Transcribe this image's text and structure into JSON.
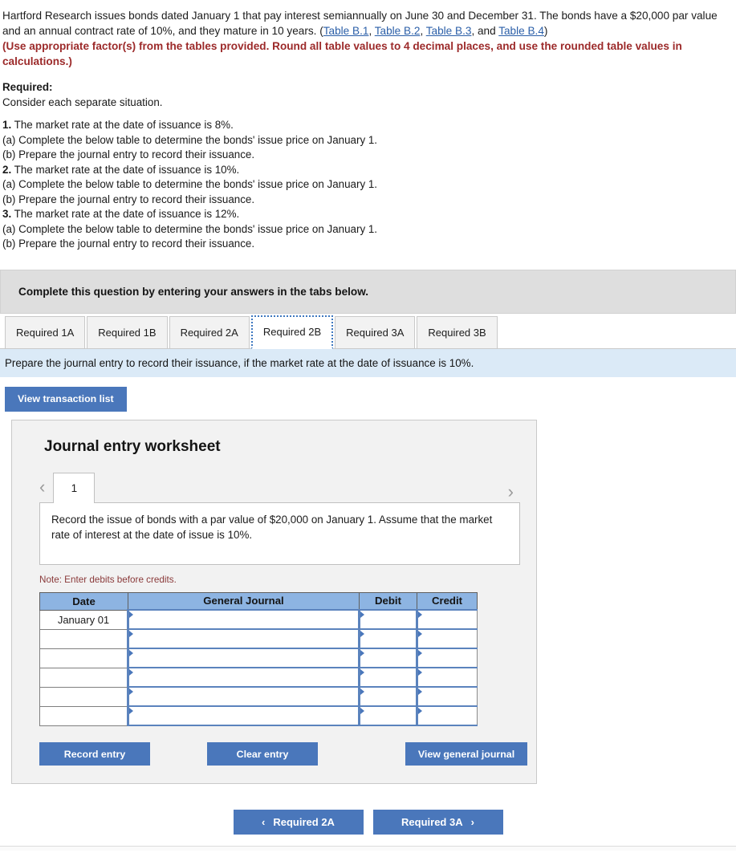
{
  "problem": {
    "paragraph_part1": "Hartford Research issues bonds dated January 1 that pay interest semiannually on June 30 and December 31. The bonds have a $20,000 par value and an annual contract rate of 10%, and they mature in 10 years. (",
    "links": [
      "Table B.1",
      "Table B.2",
      "Table B.3",
      "Table B.4"
    ],
    "sep_comma": ", ",
    "sep_and": ", and ",
    "paragraph_part2": ")",
    "emphasis": "(Use appropriate factor(s) from the tables provided. Round all table values to 4 decimal places, and use the rounded table values in calculations.)"
  },
  "required": {
    "title": "Required:",
    "subtitle": "Consider each separate situation.",
    "items": [
      {
        "num": "1.",
        "text": " The market rate at the date of issuance is 8%."
      },
      {
        "num": "",
        "text": "(a) Complete the below table to determine the bonds' issue price on January 1."
      },
      {
        "num": "",
        "text": "(b) Prepare the journal entry to record their issuance."
      },
      {
        "num": "2.",
        "text": " The market rate at the date of issuance is 10%."
      },
      {
        "num": "",
        "text": "(a) Complete the below table to determine the bonds' issue price on January 1."
      },
      {
        "num": "",
        "text": "(b) Prepare the journal entry to record their issuance."
      },
      {
        "num": "3.",
        "text": " The market rate at the date of issuance is 12%."
      },
      {
        "num": "",
        "text": "(a) Complete the below table to determine the bonds' issue price on January 1."
      },
      {
        "num": "",
        "text": "(b) Prepare the journal entry to record their issuance."
      }
    ]
  },
  "banner": {
    "grey_text": "Complete this question by entering your answers in the tabs below.",
    "blue_text": "Prepare the journal entry to record their issuance, if the market rate at the date of issuance is 10%."
  },
  "tabs": [
    {
      "label": "Required 1A",
      "active": false
    },
    {
      "label": "Required 1B",
      "active": false
    },
    {
      "label": "Required 2A",
      "active": false
    },
    {
      "label": "Required 2B",
      "active": true
    },
    {
      "label": "Required 3A",
      "active": false
    },
    {
      "label": "Required 3B",
      "active": false
    }
  ],
  "toolbar": {
    "view_transaction_list": "View transaction list"
  },
  "worksheet": {
    "title": "Journal entry worksheet",
    "prev_arrow": "‹",
    "next_arrow": "›",
    "page_number": "1",
    "description": "Record the issue of bonds with a par value of $20,000 on January 1. Assume that the market rate of interest at the date of issue is 10%.",
    "note": "Note: Enter debits before credits.",
    "table": {
      "headers": [
        "Date",
        "General Journal",
        "Debit",
        "Credit"
      ],
      "rows": [
        {
          "date": "January 01",
          "general_journal": "",
          "debit": "",
          "credit": ""
        },
        {
          "date": "",
          "general_journal": "",
          "debit": "",
          "credit": ""
        },
        {
          "date": "",
          "general_journal": "",
          "debit": "",
          "credit": ""
        },
        {
          "date": "",
          "general_journal": "",
          "debit": "",
          "credit": ""
        },
        {
          "date": "",
          "general_journal": "",
          "debit": "",
          "credit": ""
        },
        {
          "date": "",
          "general_journal": "",
          "debit": "",
          "credit": ""
        }
      ]
    },
    "actions": {
      "record_entry": "Record entry",
      "clear_entry": "Clear entry",
      "view_general_journal": "View general journal"
    }
  },
  "footer": {
    "prev_label": "Required 2A",
    "next_label": "Required 3A",
    "prev_chevron": "‹",
    "next_chevron": "›"
  },
  "colors": {
    "button_blue": "#4a77bb",
    "table_header_blue": "#8db4e2",
    "link_blue": "#2b5fa8",
    "emphasis_red": "#9c2a2a",
    "note_red": "#8a3a3a",
    "grey_banner": "#dedede",
    "blue_banner": "#dbeaf7",
    "panel_grey": "#f2f2f2"
  }
}
